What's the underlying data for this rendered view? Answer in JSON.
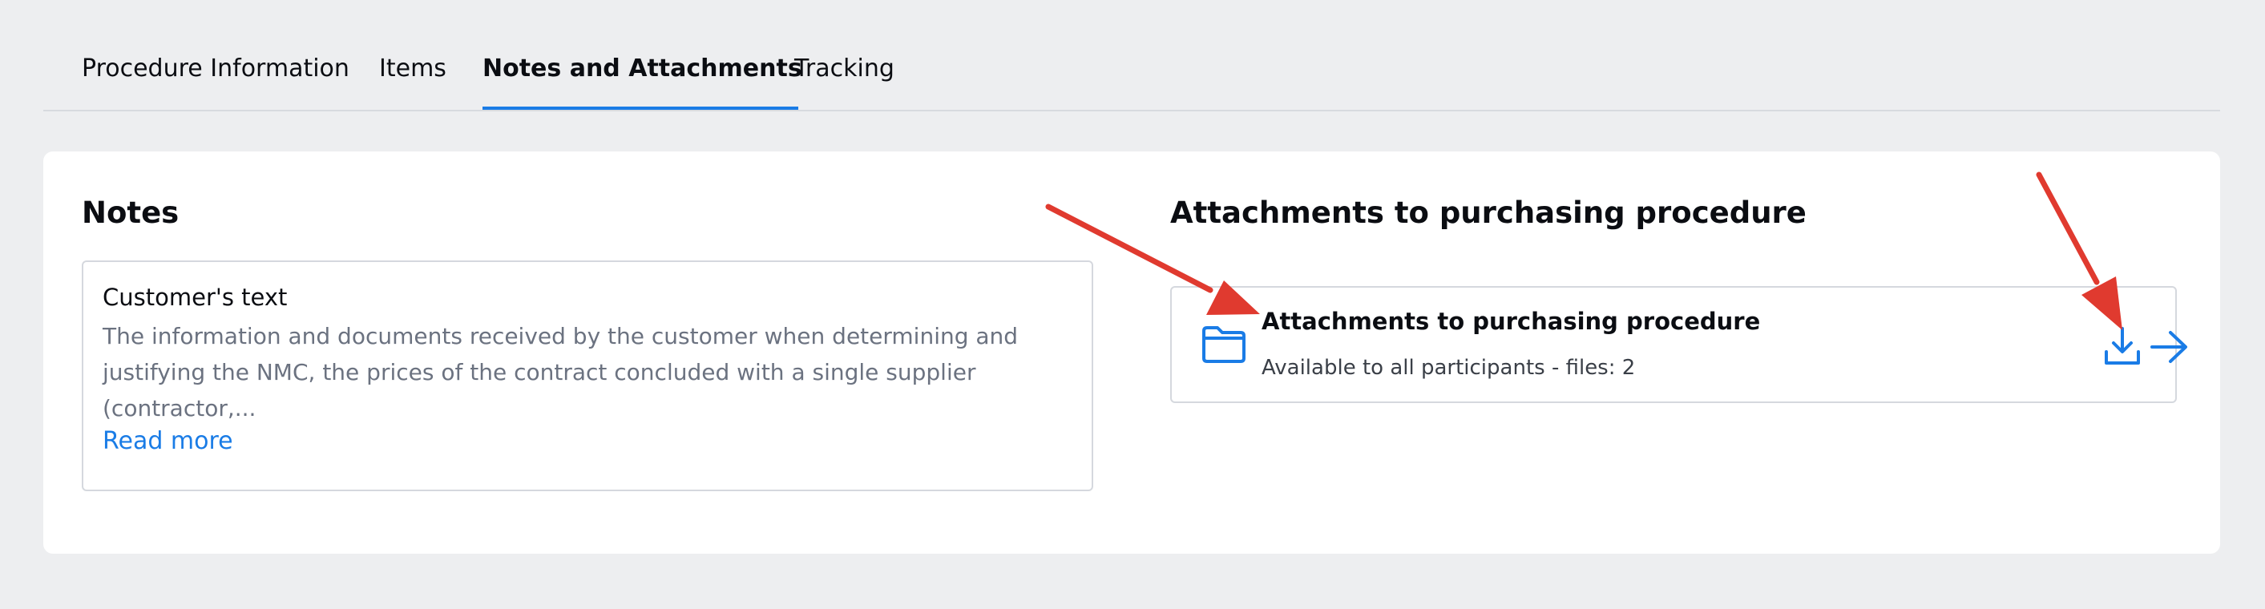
{
  "tabs": [
    {
      "label": "Procedure Information",
      "active": false
    },
    {
      "label": "Items",
      "active": false
    },
    {
      "label": "Notes and Attachments",
      "active": true
    },
    {
      "label": "Tracking",
      "active": false
    }
  ],
  "notes": {
    "title": "Notes",
    "card_title": "Customer's text",
    "card_text": "The information and documents received by the customer when determining and justifying the NMC, the prices of the contract concluded with a single supplier (contractor,...",
    "read_more": "Read more"
  },
  "attachments": {
    "title": "Attachments to purchasing procedure",
    "item_title": "Attachments to purchasing procedure",
    "item_subtitle": "Available to all participants - files: 2",
    "icons": [
      "folder-icon",
      "download-icon",
      "arrow-right-icon"
    ]
  },
  "colors": {
    "accent": "#1a7ce6",
    "annotation": "#e03a2f",
    "background": "#edeef0",
    "text": "#0b0d12",
    "muted_text": "#6b7280"
  }
}
